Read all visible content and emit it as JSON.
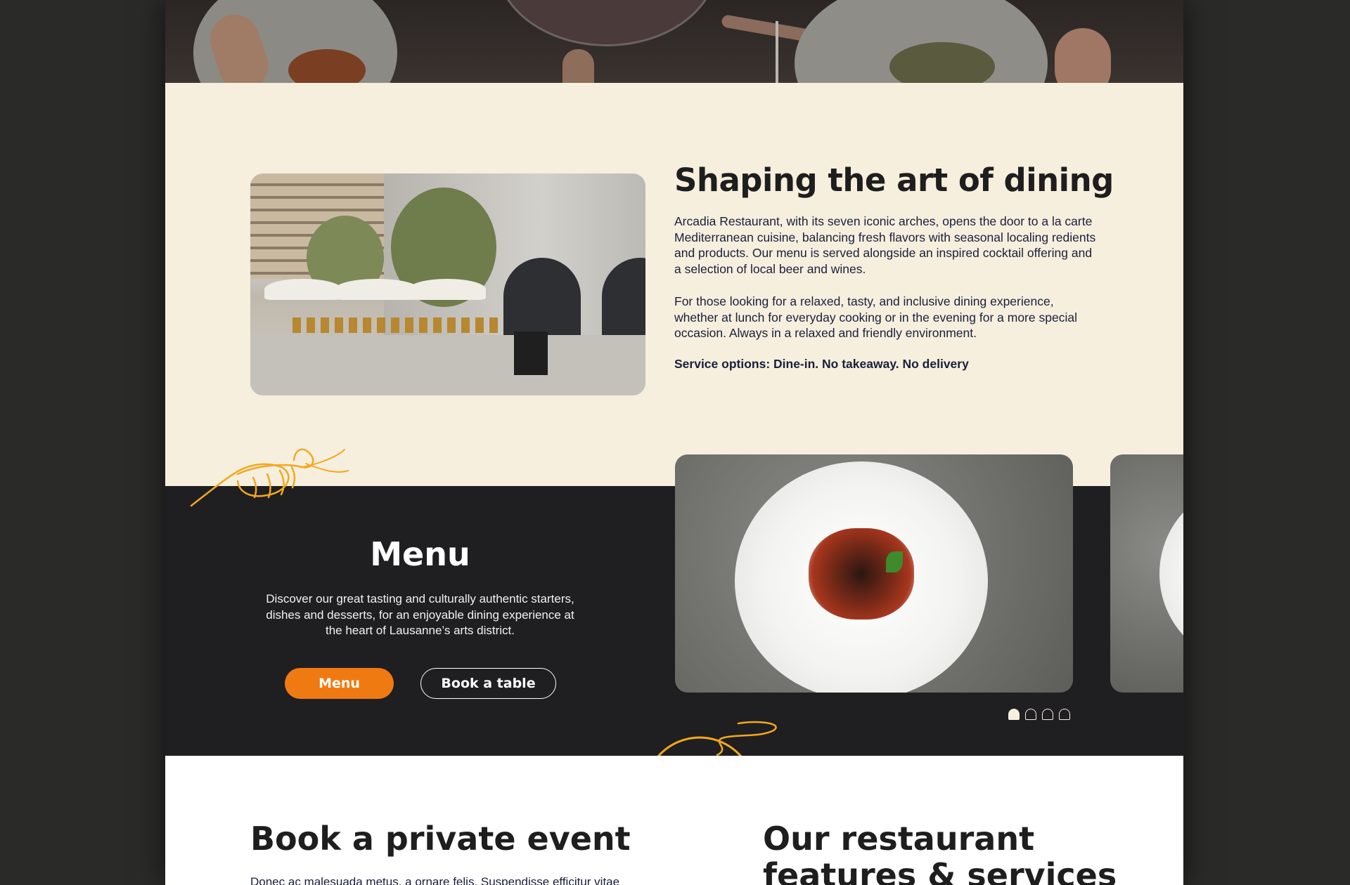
{
  "intro": {
    "title": "Shaping the art of dining",
    "paragraph1": "Arcadia Restaurant, with its seven iconic arches, opens the door to a la carte Mediterranean cuisine, balancing fresh flavors with seasonal localing redients and products. Our menu is served alongside an inspired cocktail offering and a selection of local beer and wines.",
    "paragraph2": "For those looking for a relaxed, tasty, and inclusive dining experience, whether at lunch for everyday cooking or in the evening for a more special occasion. Always in a relaxed and friendly environment.",
    "service": "Service options: Dine-in. No takeaway. No delivery"
  },
  "menu": {
    "title": "Menu",
    "description": "Discover our great tasting and culturally authentic starters, dishes and desserts, for an enjoyable dining experience at the heart of Lausanne’s arts district.",
    "menu_button": "Menu",
    "book_button": "Book a table",
    "carousel": {
      "slide_count": 4,
      "active_index": 0
    }
  },
  "bottom": {
    "private_event_title": "Book a private event",
    "features_title": "Our restaurant features & services",
    "private_event_text": "Donec ac malesuada metus, a ornare felis. Suspendisse efficitur vitae"
  },
  "colors": {
    "cream": "#f6efde",
    "dark": "#1f1f21",
    "accent_orange": "#f07a12",
    "doodle_yellow": "#f3a81f",
    "text_navy": "#1a1f3a"
  }
}
